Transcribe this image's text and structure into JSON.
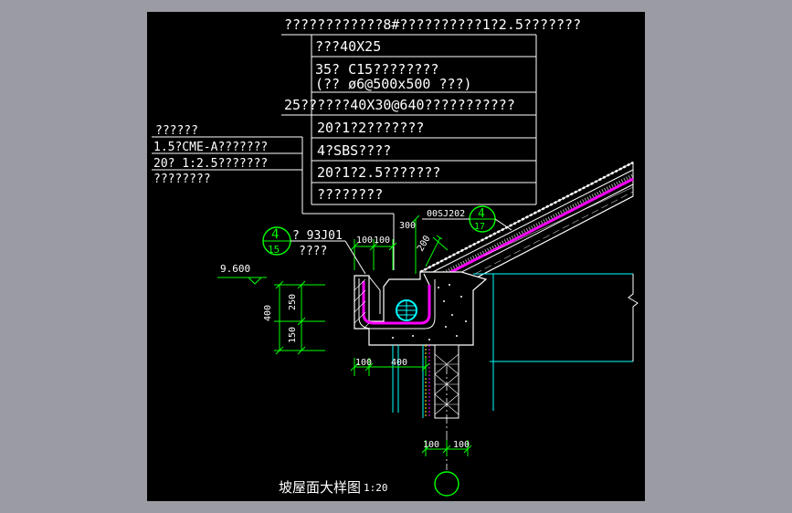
{
  "spec_right": {
    "line1": "????????????8#??????????1?2.5???????",
    "line2": "???40X25",
    "line3a": "35?  C15????????",
    "line3b": "(?? ø6@500x500         ???)",
    "line4": "25??????40X30@640???????????",
    "line5": "20?1?2???????",
    "line6": "4?SBS????",
    "line7": "20?1?2.5???????",
    "line8": "????????"
  },
  "spec_left": {
    "line1": "??????",
    "line2": "1.5?CME-A???????",
    "line3": "20?  1:2.5???????",
    "line4": "????????"
  },
  "callouts": {
    "ref_a_num": "4",
    "ref_a_sheet": "15",
    "ref_a_code": "? 93J01",
    "ref_a_label": "????",
    "ref_b_num": "4",
    "ref_b_sheet": "17",
    "ref_b_code": "00SJ202"
  },
  "dimensions": {
    "elev": "9.600",
    "d400v": "400",
    "d250": "250",
    "d150": "150",
    "d100a": "100",
    "d100b": "100",
    "d300": "300",
    "d200": "200",
    "d100c": "100",
    "d400h": "400",
    "d100d": "100",
    "d100e": "100"
  },
  "title": {
    "text": "坡屋面大样图",
    "scale": "1:20"
  },
  "colors": {
    "background": "#9b9ba3",
    "sheet": "#000000",
    "linework": "#ffffff",
    "dims": "#00ff00",
    "waterproof": "#ff00ff",
    "grid": "#00ffff",
    "hatch": "#ffff00"
  }
}
